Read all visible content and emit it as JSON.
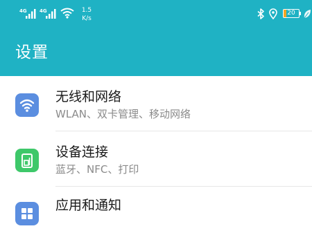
{
  "status_bar": {
    "sim1_network": "4G",
    "sim2_network": "4G",
    "speed_value": "1.5",
    "speed_unit": "K/s",
    "battery_level": "20",
    "icons": [
      "signal-icon",
      "wifi-icon",
      "bluetooth-icon",
      "location-icon",
      "battery-icon",
      "leaf-icon"
    ]
  },
  "header": {
    "title": "设置"
  },
  "colors": {
    "header_bg": "#1fb2c4",
    "wlan_icon_bg": "#5b8ee0",
    "device_icon_bg": "#3ec86a",
    "apps_icon_bg": "#5b8ee0",
    "battery_fill": "#f5a623"
  },
  "settings_items": [
    {
      "icon": "wifi-icon",
      "title": "无线和网络",
      "subtitle": "WLAN、双卡管理、移动网络"
    },
    {
      "icon": "device-connection-icon",
      "title": "设备连接",
      "subtitle": "蓝牙、NFC、打印"
    },
    {
      "icon": "apps-icon",
      "title": "应用和通知",
      "subtitle": ""
    }
  ]
}
